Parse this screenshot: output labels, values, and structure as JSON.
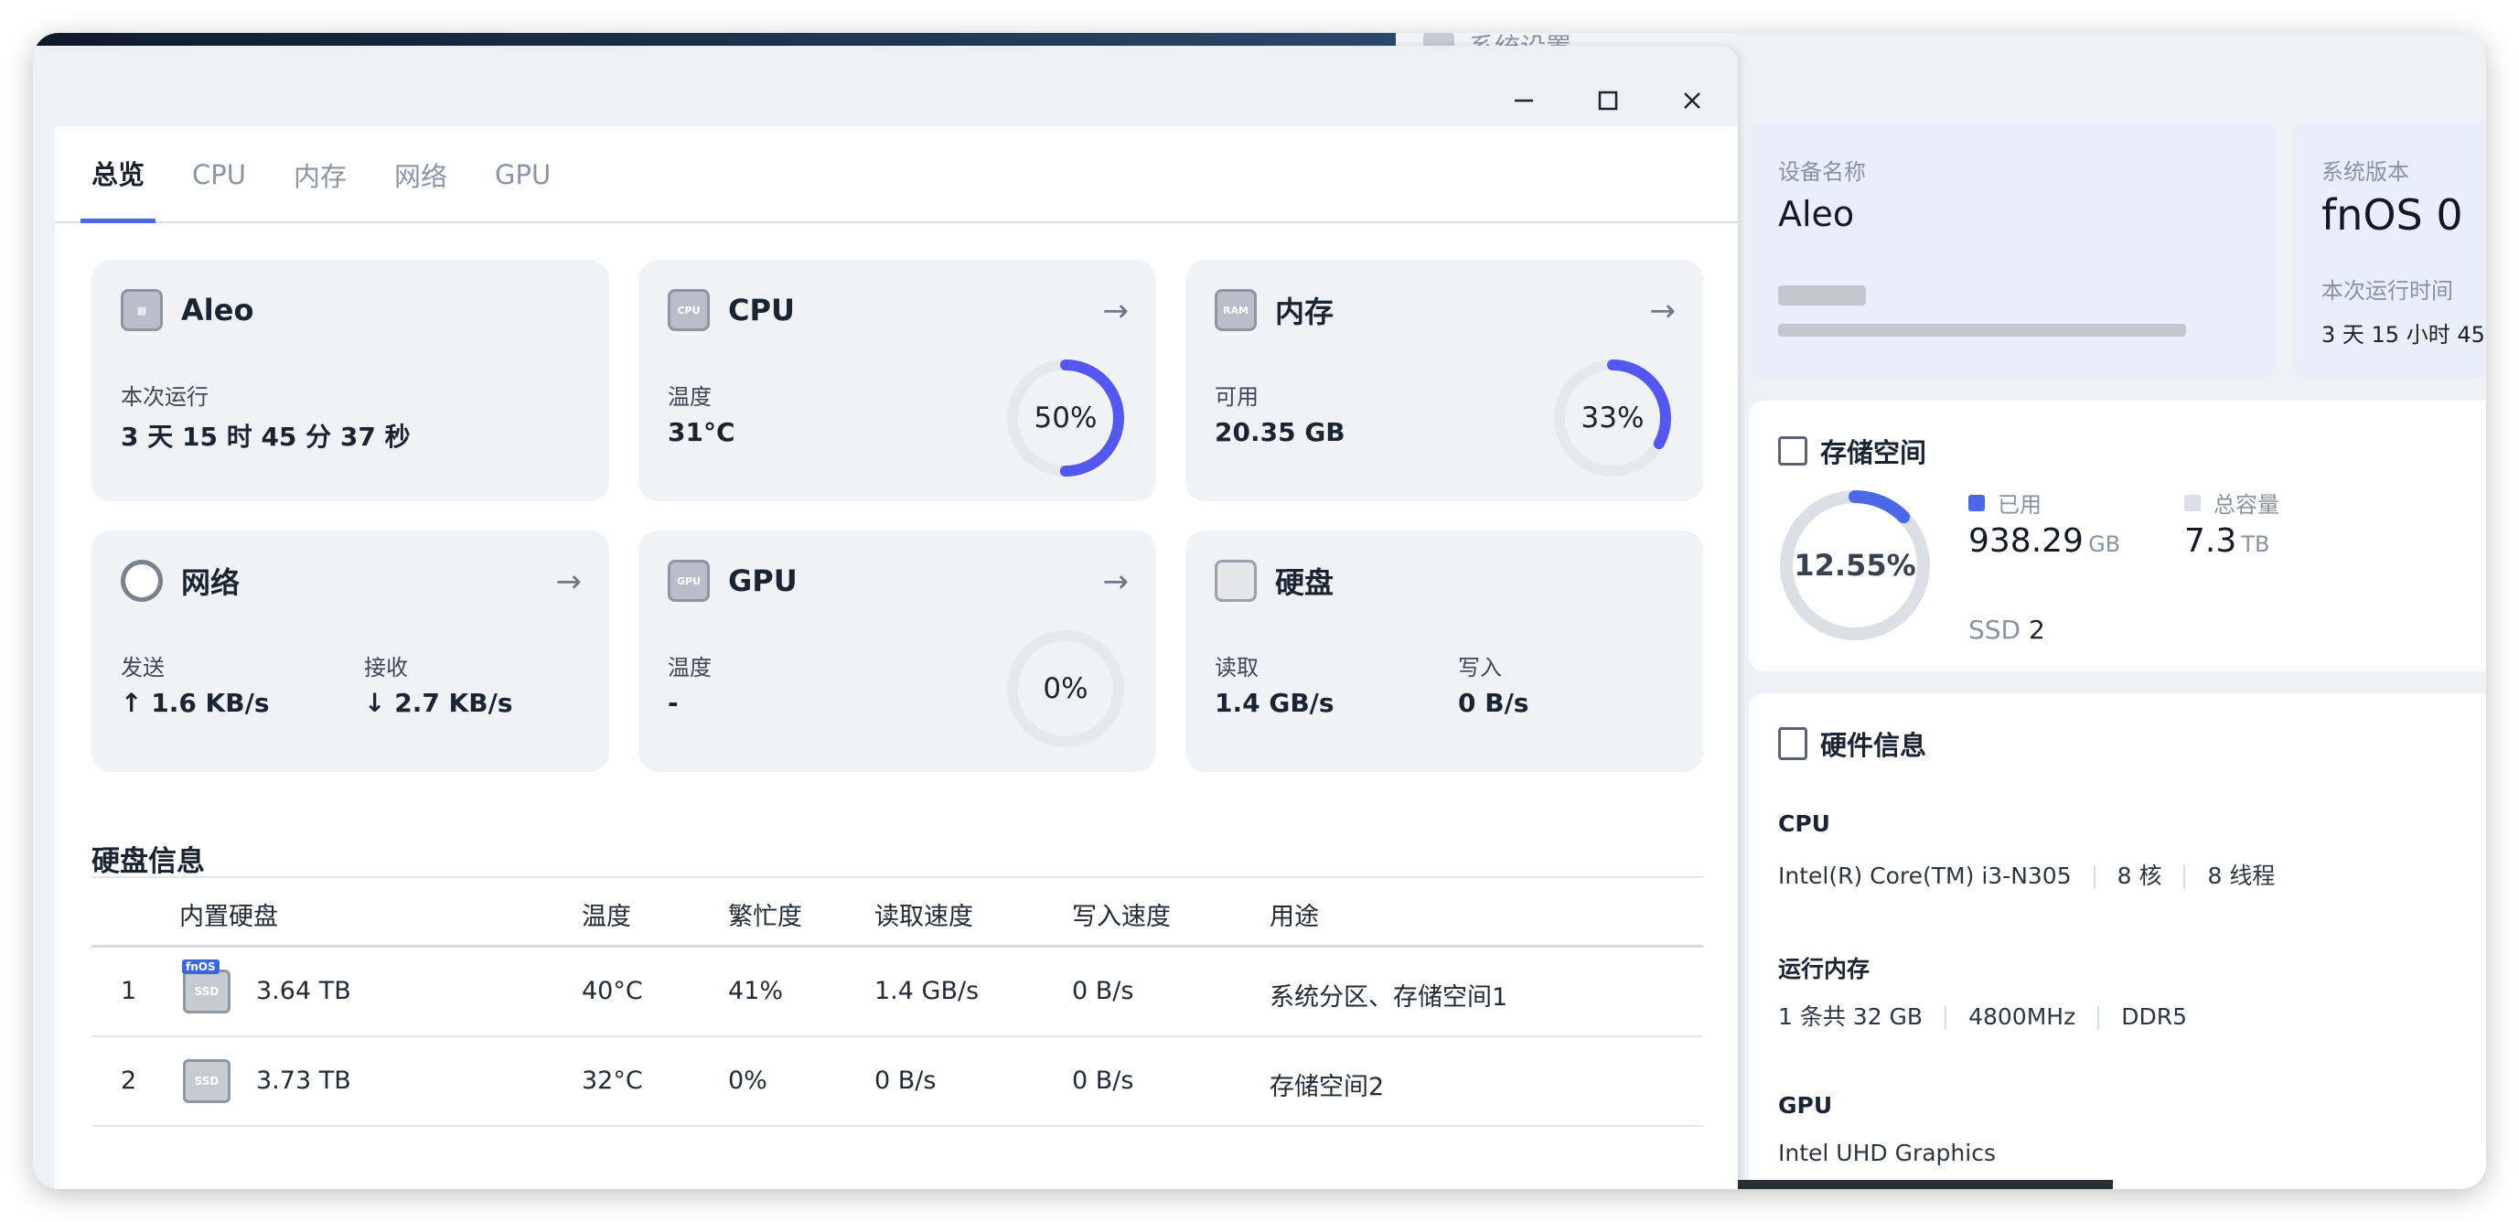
{
  "background_window": {
    "title": "系统设置"
  },
  "dialog": {
    "window_controls": {
      "minimize": "–",
      "maximize": "□",
      "close": "✕"
    },
    "tabs": [
      "总览",
      "CPU",
      "内存",
      "网络",
      "GPU"
    ],
    "cards": {
      "device": {
        "name": "Aleo",
        "uptime_label": "本次运行",
        "uptime_value": "3 天 15 时 45 分 37 秒"
      },
      "cpu": {
        "title": "CPU",
        "temp_label": "温度",
        "temp_value": "31°C",
        "usage": "50%",
        "usage_fraction": 0.5
      },
      "memory": {
        "title": "内存",
        "avail_label": "可用",
        "avail_value": "20.35 GB",
        "usage": "33%",
        "usage_fraction": 0.33
      },
      "network": {
        "title": "网络",
        "send_label": "发送",
        "send_value": "↑ 1.6 KB/s",
        "recv_label": "接收",
        "recv_value": "↓ 2.7 KB/s"
      },
      "gpu": {
        "title": "GPU",
        "temp_label": "温度",
        "temp_value": "-",
        "usage": "0%",
        "usage_fraction": 0
      },
      "disk": {
        "title": "硬盘",
        "read_label": "读取",
        "read_value": "1.4 GB/s",
        "write_label": "写入",
        "write_value": "0 B/s"
      }
    },
    "disk_info": {
      "title": "硬盘信息",
      "headers": [
        "内置硬盘",
        "温度",
        "繁忙度",
        "读取速度",
        "写入速度",
        "用途"
      ],
      "rows": [
        {
          "index": "1",
          "badge": "fnOS",
          "size": "3.64 TB",
          "temp": "40°C",
          "busy": "41%",
          "read": "1.4 GB/s",
          "write": "0 B/s",
          "usage": "系统分区、存储空间1"
        },
        {
          "index": "2",
          "badge": "",
          "size": "3.73 TB",
          "temp": "32°C",
          "busy": "0%",
          "read": "0 B/s",
          "write": "0 B/s",
          "usage": "存储空间2"
        }
      ]
    }
  },
  "right_panel": {
    "device_name_label": "设备名称",
    "device_name": "Aleo",
    "system_version_label": "系统版本",
    "system_version": "fnOS 0",
    "uptime_label": "本次运行时间",
    "uptime_value": "3 天 15 小时 45",
    "storage": {
      "title": "存储空间",
      "percent": "12.55%",
      "used_fraction": 0.1255,
      "used_label": "已用",
      "used_value": "938.29",
      "used_unit": "GB",
      "total_label": "总容量",
      "total_value": "7.3",
      "total_unit": "TB",
      "ssd_label": "SSD",
      "ssd_count": "2"
    },
    "hardware": {
      "title": "硬件信息",
      "cpu_label": "CPU",
      "cpu_model": "Intel(R) Core(TM) i3-N305",
      "cpu_cores": "8 核",
      "cpu_threads": "8 线程",
      "ram_label": "运行内存",
      "ram_size": "1 条共 32 GB",
      "ram_freq": "4800MHz",
      "ram_type": "DDR5",
      "gpu_label": "GPU",
      "gpu_model": "Intel UHD Graphics"
    }
  },
  "colors": {
    "accent": "#4b68e6",
    "ring_track": "#e6e8ee",
    "ring_fill": "#5258f0"
  }
}
